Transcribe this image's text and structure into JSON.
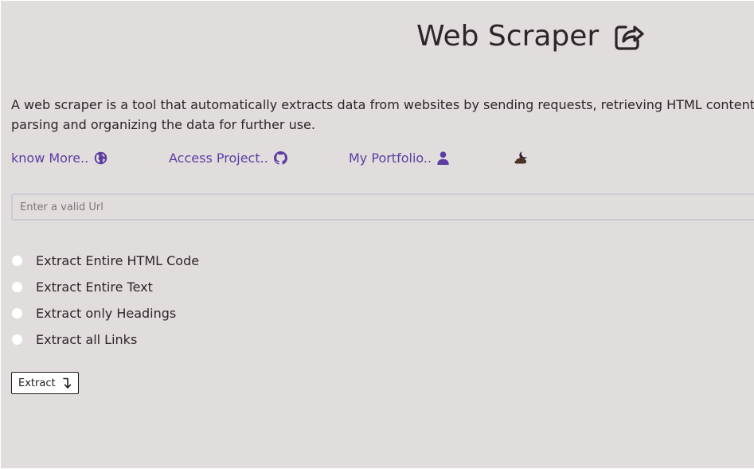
{
  "header": {
    "title": "Web Scraper",
    "share_icon": "share-square-icon"
  },
  "intro": {
    "description": "A web scraper is a tool that automatically extracts data from websites by sending requests, retrieving HTML content, parsing and organizing the data for further use."
  },
  "links": [
    {
      "label": "know More..",
      "icon": "globe-icon"
    },
    {
      "label": "Access Project..",
      "icon": "github-icon"
    },
    {
      "label": "My Portfolio..",
      "icon": "user-icon"
    }
  ],
  "theme_toggle": {
    "icon": "cloud-moon-icon"
  },
  "url_input": {
    "value": "",
    "placeholder": "Enter a valid Url"
  },
  "options": [
    {
      "label": "Extract Entire HTML Code",
      "checked": false
    },
    {
      "label": "Extract Entire Text",
      "checked": false
    },
    {
      "label": "Extract only Headings",
      "checked": false
    },
    {
      "label": "Extract all Links",
      "checked": false
    }
  ],
  "extract_button": {
    "label": "Extract",
    "icon": "arrow-down-turn-icon"
  },
  "colors": {
    "background": "#e2dddd",
    "text": "#2d2529",
    "link": "#5b3ea0",
    "radio": "#ffffff"
  }
}
